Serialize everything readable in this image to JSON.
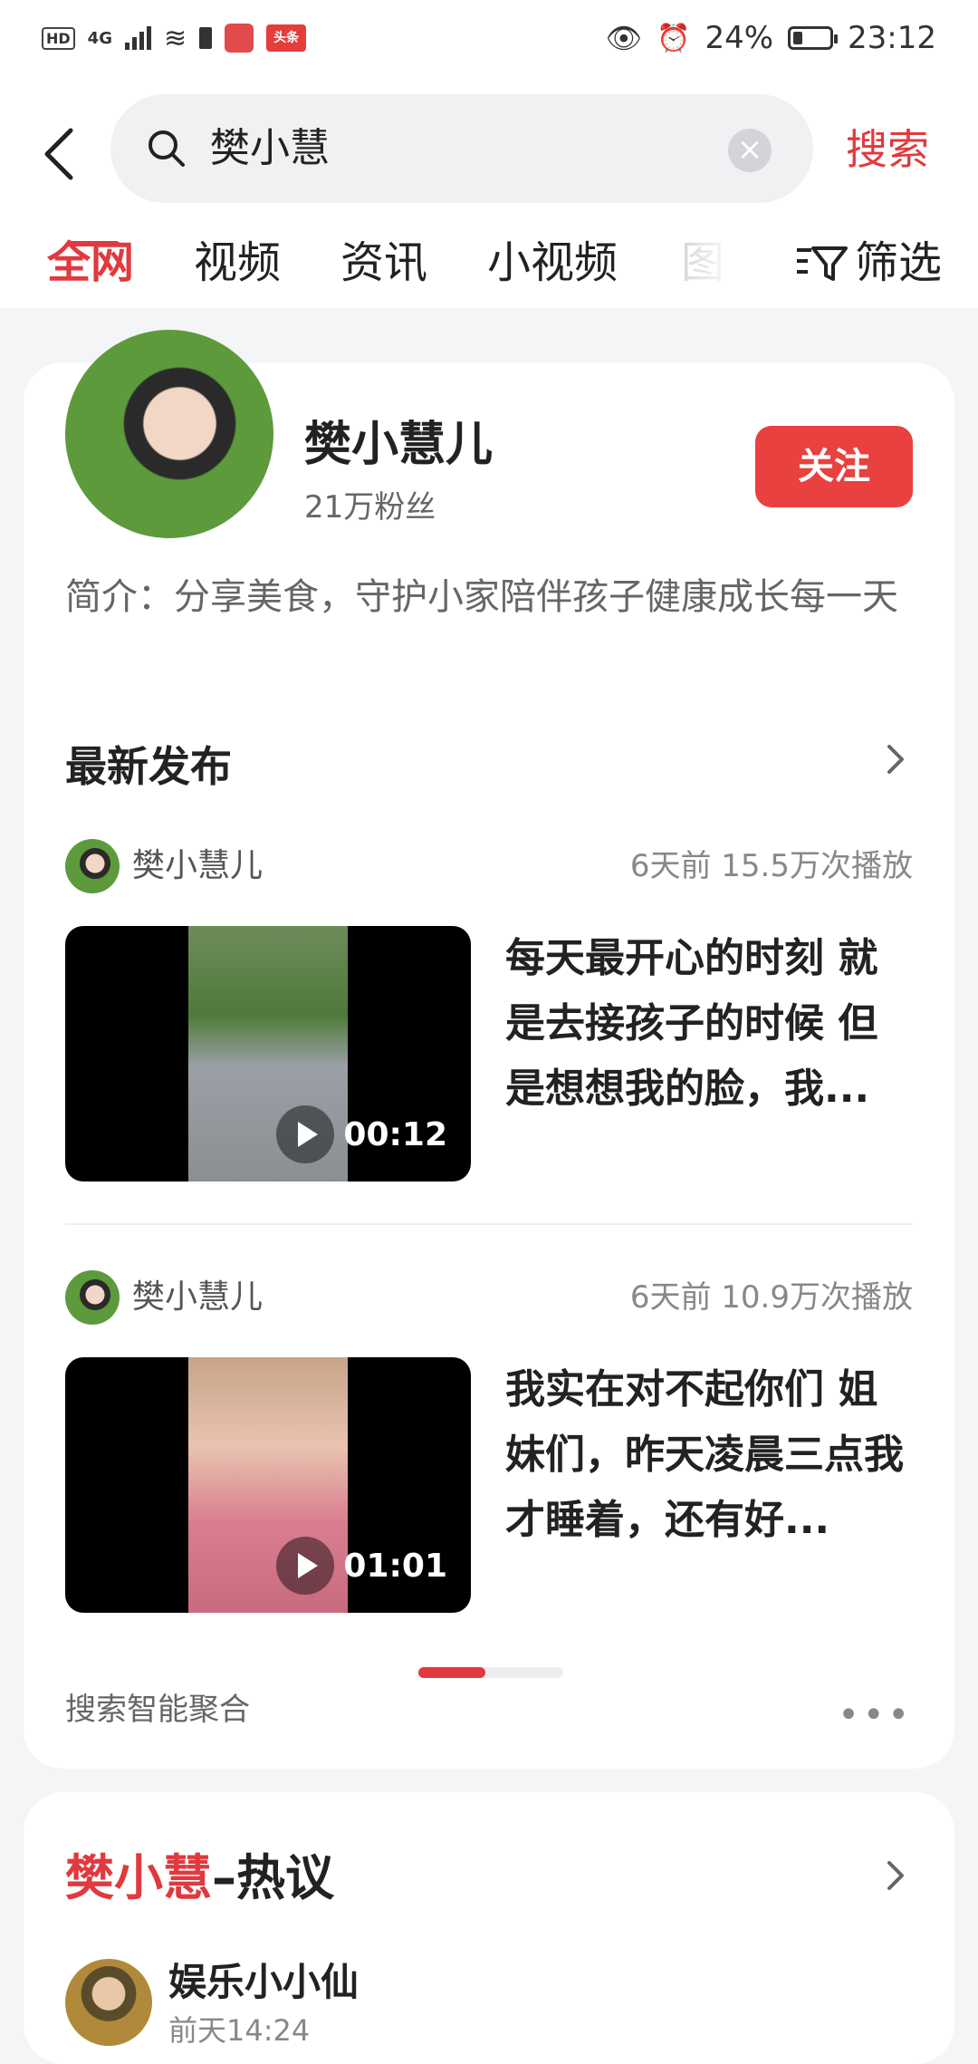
{
  "status_bar": {
    "left_badge": "HD",
    "network": "4G",
    "app_badge": "头条",
    "battery": "24%",
    "time": "23:12"
  },
  "search": {
    "query": "樊小慧",
    "button": "搜索"
  },
  "tabs": [
    "全网",
    "视频",
    "资讯",
    "小视频",
    "图"
  ],
  "filter_label": "筛选",
  "profile": {
    "name": "樊小慧儿",
    "fans": "21万粉丝",
    "follow": "关注",
    "bio": "简介：分享美食，守护小家陪伴孩子健康成长每一天"
  },
  "latest": {
    "title": "最新发布",
    "posts": [
      {
        "author": "樊小慧儿",
        "meta": "6天前   15.5万次播放",
        "duration": "00:12",
        "title": "每天最开心的时刻 就是去接孩子的时候 但是想想我的脸，我..."
      },
      {
        "author": "樊小慧儿",
        "meta": "6天前   10.9万次播放",
        "duration": "01:01",
        "title": "我实在对不起你们 姐妹们，昨天凌晨三点我才睡着，还有好..."
      }
    ]
  },
  "aggregate_label": "搜索智能聚合",
  "more_label": "•••",
  "hot": {
    "keyword": "樊小慧",
    "suffix": "–热议",
    "user": "娱乐小小仙",
    "time": "前天14:24"
  },
  "colors": {
    "accent": "#e0393e",
    "follow_bg": "#e8413f"
  }
}
